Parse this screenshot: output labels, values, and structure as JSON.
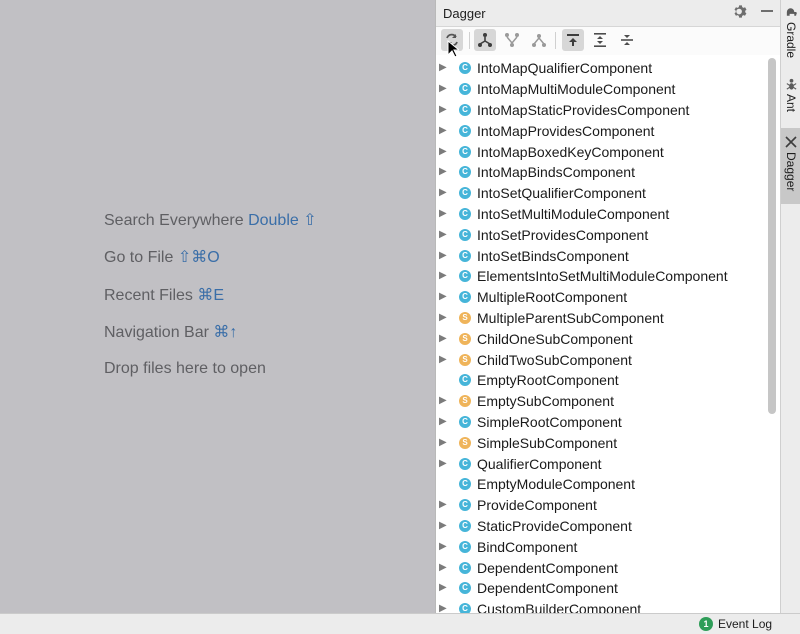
{
  "editor": {
    "hints": [
      {
        "text": "Search Everywhere ",
        "key": "Double ⇧"
      },
      {
        "text": "Go to File ",
        "key": "⇧⌘O"
      },
      {
        "text": "Recent Files ",
        "key": "⌘E"
      },
      {
        "text": "Navigation Bar ",
        "key": "⌘↑"
      },
      {
        "text": "Drop files here to open",
        "key": ""
      }
    ]
  },
  "panel": {
    "title": "Dagger"
  },
  "tree": {
    "items": [
      {
        "label": "IntoMapQualifierComponent",
        "type": "C",
        "expandable": true
      },
      {
        "label": "IntoMapMultiModuleComponent",
        "type": "C",
        "expandable": true
      },
      {
        "label": "IntoMapStaticProvidesComponent",
        "type": "C",
        "expandable": true
      },
      {
        "label": "IntoMapProvidesComponent",
        "type": "C",
        "expandable": true
      },
      {
        "label": "IntoMapBoxedKeyComponent",
        "type": "C",
        "expandable": true
      },
      {
        "label": "IntoMapBindsComponent",
        "type": "C",
        "expandable": true
      },
      {
        "label": "IntoSetQualifierComponent",
        "type": "C",
        "expandable": true
      },
      {
        "label": "IntoSetMultiModuleComponent",
        "type": "C",
        "expandable": true
      },
      {
        "label": "IntoSetProvidesComponent",
        "type": "C",
        "expandable": true
      },
      {
        "label": "IntoSetBindsComponent",
        "type": "C",
        "expandable": true
      },
      {
        "label": "ElementsIntoSetMultiModuleComponent",
        "type": "C",
        "expandable": true
      },
      {
        "label": "MultipleRootComponent",
        "type": "C",
        "expandable": true
      },
      {
        "label": "MultipleParentSubComponent",
        "type": "S",
        "expandable": true
      },
      {
        "label": "ChildOneSubComponent",
        "type": "S",
        "expandable": true
      },
      {
        "label": "ChildTwoSubComponent",
        "type": "S",
        "expandable": true
      },
      {
        "label": "EmptyRootComponent",
        "type": "C",
        "expandable": false
      },
      {
        "label": "EmptySubComponent",
        "type": "S",
        "expandable": true
      },
      {
        "label": "SimpleRootComponent",
        "type": "C",
        "expandable": true
      },
      {
        "label": "SimpleSubComponent",
        "type": "S",
        "expandable": true
      },
      {
        "label": "QualifierComponent",
        "type": "C",
        "expandable": true
      },
      {
        "label": "EmptyModuleComponent",
        "type": "C",
        "expandable": false
      },
      {
        "label": "ProvideComponent",
        "type": "C",
        "expandable": true
      },
      {
        "label": "StaticProvideComponent",
        "type": "C",
        "expandable": true
      },
      {
        "label": "BindComponent",
        "type": "C",
        "expandable": true
      },
      {
        "label": "DependentComponent",
        "type": "C",
        "expandable": true
      },
      {
        "label": "DependentComponent",
        "type": "C",
        "expandable": true
      },
      {
        "label": "CustomBuilderComponent",
        "type": "C",
        "expandable": true
      }
    ]
  },
  "stripe": {
    "tabs": [
      {
        "label": "Gradle",
        "icon": "gradle-elephant-icon"
      },
      {
        "label": "Ant",
        "icon": "ant-icon"
      },
      {
        "label": "Dagger",
        "icon": "dagger-icon",
        "active": true
      }
    ]
  },
  "statusbar": {
    "event_count": "1",
    "event_label": "Event Log"
  },
  "colors": {
    "editor_bg": "#c1c0c4",
    "hint_text": "#5f5f63",
    "hint_key": "#3a6ea8",
    "component_badge": "#46b5d9",
    "subcomponent_badge": "#efb45a",
    "event_badge": "#2e9d58"
  }
}
